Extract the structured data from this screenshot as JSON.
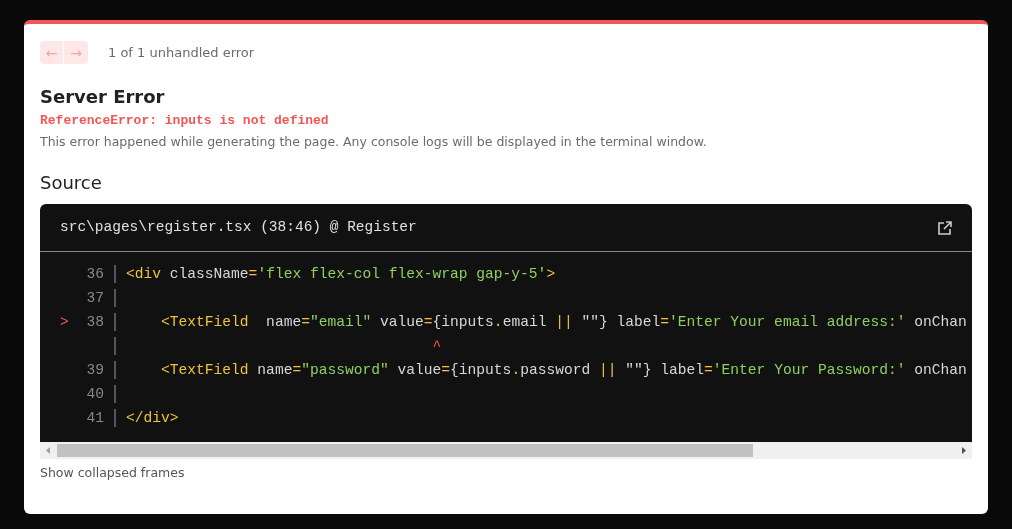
{
  "pager": {
    "prev_icon": "←",
    "next_icon": "→",
    "label": "1 of 1 unhandled error"
  },
  "error": {
    "title": "Server Error",
    "message": "ReferenceError: inputs is not defined",
    "description": "This error happened while generating the page. Any console logs will be displayed in the terminal window."
  },
  "source": {
    "heading": "Source",
    "file": "src\\pages\\register.tsx (38:46) @ Register",
    "lines": [
      {
        "number": "36",
        "tokens": [
          {
            "kind": "tag",
            "text": "<div"
          },
          {
            "kind": "plain",
            "text": " className"
          },
          {
            "kind": "punct",
            "text": "="
          },
          {
            "kind": "string",
            "text": "'flex flex-col flex-wrap gap-y-5'"
          },
          {
            "kind": "tag",
            "text": ">"
          }
        ]
      },
      {
        "number": "37"
      },
      {
        "number": "38",
        "marker": ">",
        "tokens": [
          {
            "kind": "tag",
            "text": "    <TextField"
          },
          {
            "kind": "plain",
            "text": "  name"
          },
          {
            "kind": "punct",
            "text": "="
          },
          {
            "kind": "string",
            "text": "\"email\""
          },
          {
            "kind": "plain",
            "text": " value"
          },
          {
            "kind": "punct",
            "text": "="
          },
          {
            "kind": "plain",
            "text": "{inputs"
          },
          {
            "kind": "punct",
            "text": "."
          },
          {
            "kind": "plain",
            "text": "email "
          },
          {
            "kind": "punct",
            "text": "||"
          },
          {
            "kind": "plain",
            "text": " \"\"} label"
          },
          {
            "kind": "punct",
            "text": "="
          },
          {
            "kind": "string",
            "text": "'Enter Your email address:'"
          },
          {
            "kind": "plain",
            "text": " onChan"
          }
        ]
      },
      {
        "caret": "                                   ^"
      },
      {
        "number": "39",
        "tokens": [
          {
            "kind": "tag",
            "text": "    <TextField"
          },
          {
            "kind": "plain",
            "text": " name"
          },
          {
            "kind": "punct",
            "text": "="
          },
          {
            "kind": "string",
            "text": "\"password\""
          },
          {
            "kind": "plain",
            "text": " value"
          },
          {
            "kind": "punct",
            "text": "="
          },
          {
            "kind": "plain",
            "text": "{inputs"
          },
          {
            "kind": "punct",
            "text": "."
          },
          {
            "kind": "plain",
            "text": "password "
          },
          {
            "kind": "punct",
            "text": "||"
          },
          {
            "kind": "plain",
            "text": " \"\"} label"
          },
          {
            "kind": "punct",
            "text": "="
          },
          {
            "kind": "string",
            "text": "'Enter Your Password:'"
          },
          {
            "kind": "plain",
            "text": " onChan"
          }
        ]
      },
      {
        "number": "40"
      },
      {
        "number": "41",
        "tokens": [
          {
            "kind": "tag",
            "text": "</div>"
          }
        ]
      }
    ]
  },
  "footer_link": "Show collapsed frames"
}
